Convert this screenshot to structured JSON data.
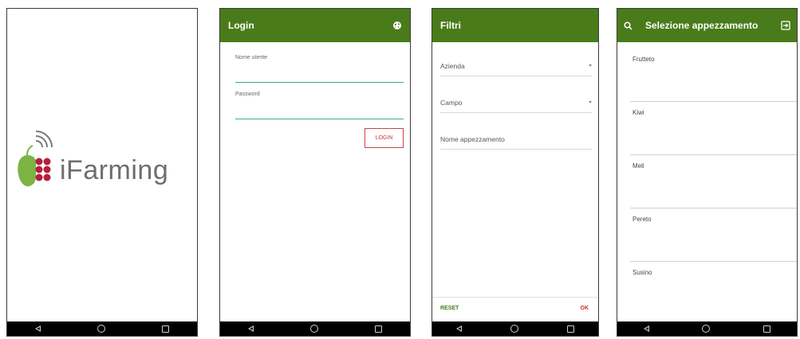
{
  "splash": {
    "logo_text": "iFarming"
  },
  "login": {
    "title": "Login",
    "username_label": "Nome utente",
    "password_label": "Password",
    "login_button": "LOGIN"
  },
  "filters": {
    "title": "Filtri",
    "fields": [
      "Azienda",
      "Campo",
      "Nome appezzamento"
    ],
    "reset_button": "RESET",
    "ok_button": "OK"
  },
  "plot_select": {
    "title": "Selezione appezzamento",
    "items": [
      "Frutteto",
      "Kiwi",
      "Meli",
      "Pereto",
      "Susino"
    ]
  },
  "colors": {
    "primary": "#4a7b1a",
    "accent": "#3aa89a",
    "logo_red": "#b3203c",
    "logo_green": "#7cb342"
  },
  "icons": [
    "globe-icon",
    "search-icon",
    "exit-icon",
    "back-icon",
    "home-icon",
    "recent-apps-icon"
  ]
}
